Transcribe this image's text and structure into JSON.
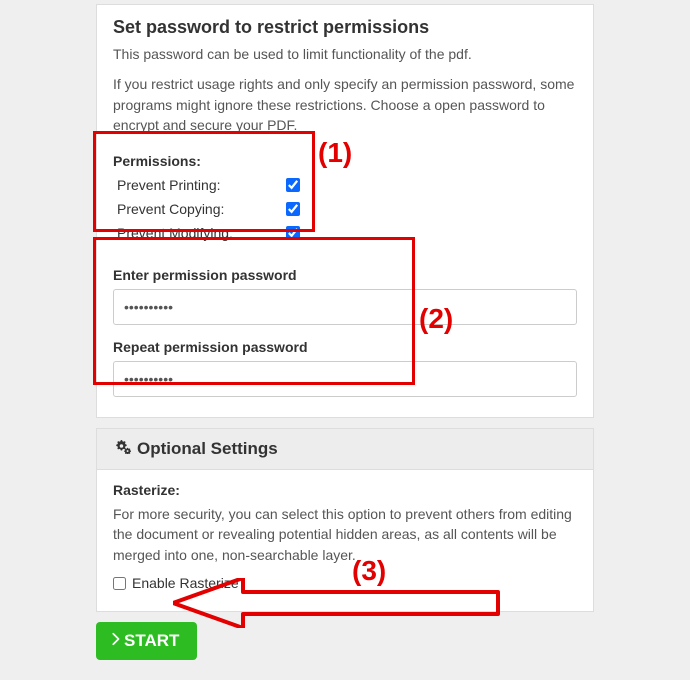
{
  "section1": {
    "title": "Set password to restrict permissions",
    "desc1": "This password can be used to limit functionality of the pdf.",
    "desc2": "If you restrict usage rights and only specify an permission password, some programs might ignore these restrictions. Choose a open password to encrypt and secure your PDF.",
    "permissions_label": "Permissions:",
    "perms": [
      {
        "label": "Prevent Printing:",
        "checked": true
      },
      {
        "label": "Prevent Copying:",
        "checked": true
      },
      {
        "label": "Prevent Modifying:",
        "checked": true
      }
    ],
    "pw1_label": "Enter permission password",
    "pw1_value": "••••••••••",
    "pw2_label": "Repeat permission password",
    "pw2_value": "••••••••••"
  },
  "section2": {
    "header": "Optional Settings",
    "raster_label": "Rasterize:",
    "raster_desc": "For more security, you can select this option to prevent others from editing the document or revealing potential hidden areas, as all contents will be merged into one, non-searchable layer.",
    "enable_raster_label": "Enable Rasterize",
    "enable_raster_checked": false
  },
  "start_label": "START",
  "annotations": {
    "a1": "(1)",
    "a2": "(2)",
    "a3": "(3)"
  }
}
